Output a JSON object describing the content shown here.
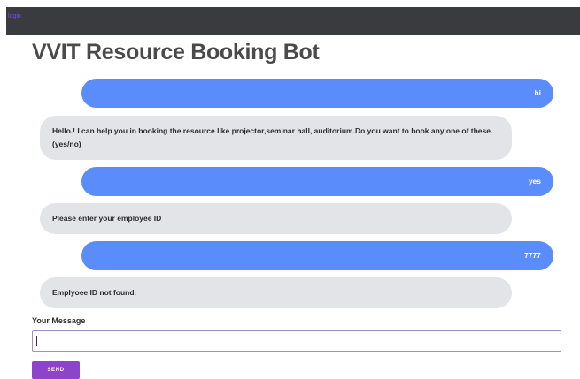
{
  "nav": {
    "login_label": "login"
  },
  "page": {
    "title": "VVIT Resource Booking Bot"
  },
  "chat": {
    "messages": [
      {
        "sender": "user",
        "text": "hi"
      },
      {
        "sender": "bot",
        "text": "Hello.! I can help you in booking the resource like projector,seminar hall, auditorium.Do you want to book any one of these.(yes/no)"
      },
      {
        "sender": "user",
        "text": "yes"
      },
      {
        "sender": "bot",
        "text": "Please enter your employee ID"
      },
      {
        "sender": "user",
        "text": "7777"
      },
      {
        "sender": "bot",
        "text": "Emplyoee ID not found."
      }
    ]
  },
  "composer": {
    "label": "Your Message",
    "value": "",
    "send_label": "SEND"
  },
  "colors": {
    "topbar": "#3a3b3e",
    "user_bubble": "#5a8cfb",
    "bot_bubble": "#e3e4e8",
    "send_button": "#8e44c9",
    "login_link": "#7c4dff"
  }
}
